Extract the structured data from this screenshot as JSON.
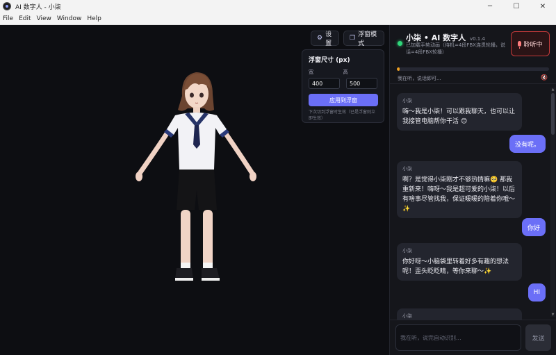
{
  "window": {
    "title": "AI 数字人 - 小柒",
    "controls": {
      "minimize": "─",
      "maximize": "☐",
      "close": "✕"
    }
  },
  "menu": [
    "File",
    "Edit",
    "View",
    "Window",
    "Help"
  ],
  "stage": {
    "settings_label": "设置",
    "settings_icon": "gear-icon",
    "float_mode_label": "浮窗模式",
    "float_icon": "window-icon",
    "float_panel": {
      "title": "浮窗尺寸 (px)",
      "width_label": "宽",
      "height_label": "高",
      "width_value": "400",
      "height_value": "500",
      "apply_label": "应用到浮窗",
      "hint": "下次切到浮窗时生效（已是浮窗则立即生效）"
    }
  },
  "chat": {
    "title": "小柒 • AI 数字人",
    "version": "v0.1.4",
    "subtitle": "已加载手势动画（待机=4段FBX连贯轮播，说话=4段FBX轮播）",
    "listen_label": "聆听中",
    "status_color": "#2fd67a",
    "accent_color": "#6b6ff7",
    "voice_level": 0.02,
    "listen_status": "我在听，说话即可...",
    "messages": [
      {
        "role": "ai",
        "name": "小柒",
        "text": "嗨～我是小柒！可以跟我聊天，也可以让我接管电脑帮你干活 😊"
      },
      {
        "role": "user",
        "text": "没有呢。"
      },
      {
        "role": "ai",
        "name": "小柒",
        "text": "啊？是觉得小柒刚才不够热情嘛🥺 那我重新来！嗨呀～我是超可爱的小柒！以后有啥事尽管找我，保证暖暖的陪着你哦～✨"
      },
      {
        "role": "user",
        "text": "你好"
      },
      {
        "role": "ai",
        "name": "小柒",
        "text": "你好呀～小脑袋里转着好多有趣的想法呢！歪头眨眨睛，等你来聊～✨"
      },
      {
        "role": "user",
        "text": "HI"
      },
      {
        "role": "ai",
        "name": "小柒",
        "text": ""
      }
    ],
    "input_placeholder": "我在听，说完自动识别...",
    "send_label": "发送"
  }
}
